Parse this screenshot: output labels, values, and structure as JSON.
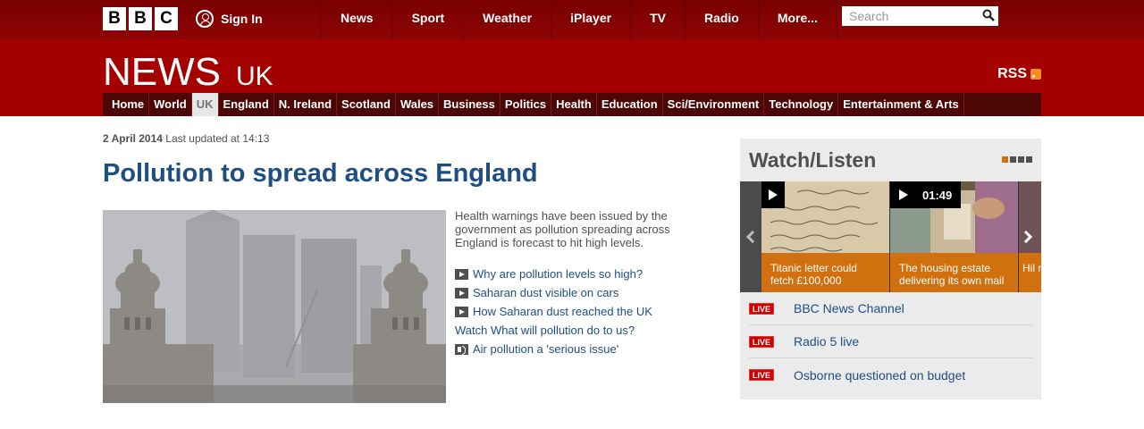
{
  "global_nav": {
    "logo_letters": [
      "B",
      "B",
      "C"
    ],
    "signin_label": "Sign In",
    "items": [
      {
        "label": "News"
      },
      {
        "label": "Sport"
      },
      {
        "label": "Weather"
      },
      {
        "label": "iPlayer"
      },
      {
        "label": "TV"
      },
      {
        "label": "Radio"
      },
      {
        "label": "More..."
      }
    ],
    "search_placeholder": "Search",
    "bar_color": "#7a0000"
  },
  "news_header": {
    "brand": "NEWS",
    "edition": "UK",
    "rss_label": "RSS",
    "header_color": "#a50000",
    "sections": [
      {
        "label": "Home"
      },
      {
        "label": "World"
      },
      {
        "label": "UK",
        "active": true
      },
      {
        "label": "England"
      },
      {
        "label": "N. Ireland"
      },
      {
        "label": "Scotland"
      },
      {
        "label": "Wales"
      },
      {
        "label": "Business"
      },
      {
        "label": "Politics"
      },
      {
        "label": "Health"
      },
      {
        "label": "Education"
      },
      {
        "label": "Sci/Environment"
      },
      {
        "label": "Technology"
      },
      {
        "label": "Entertainment & Arts"
      }
    ]
  },
  "article": {
    "date": "2 April 2014",
    "updated": "Last updated at 14:13",
    "headline": "Pollution to spread across England",
    "summary": "Health warnings have been issued by the government as pollution spreading across England is forecast to hit high levels.",
    "related": [
      {
        "label": "Why are pollution levels so high?",
        "media": "video-icon"
      },
      {
        "label": "Saharan dust visible on cars",
        "media": "video-icon"
      },
      {
        "label": "How Saharan dust reached the UK",
        "media": "video-icon"
      },
      {
        "label": "Watch What will pollution do to us?",
        "media": "none"
      },
      {
        "label": "Air pollution a 'serious issue'",
        "media": "audio-icon"
      }
    ],
    "headline_color": "#1f4f82"
  },
  "watch_listen": {
    "title": "Watch/Listen",
    "accent_color": "#d1700e",
    "cards": [
      {
        "caption": "Titanic letter could fetch £100,000",
        "duration": ""
      },
      {
        "caption": "The housing estate delivering its own mail",
        "duration": "01:49"
      },
      {
        "caption": "Hil no",
        "duration": ""
      }
    ],
    "live": [
      {
        "badge": "LIVE",
        "label": "BBC News Channel"
      },
      {
        "badge": "LIVE",
        "label": "Radio 5 live"
      },
      {
        "badge": "LIVE",
        "label": "Osborne questioned on budget"
      }
    ]
  }
}
